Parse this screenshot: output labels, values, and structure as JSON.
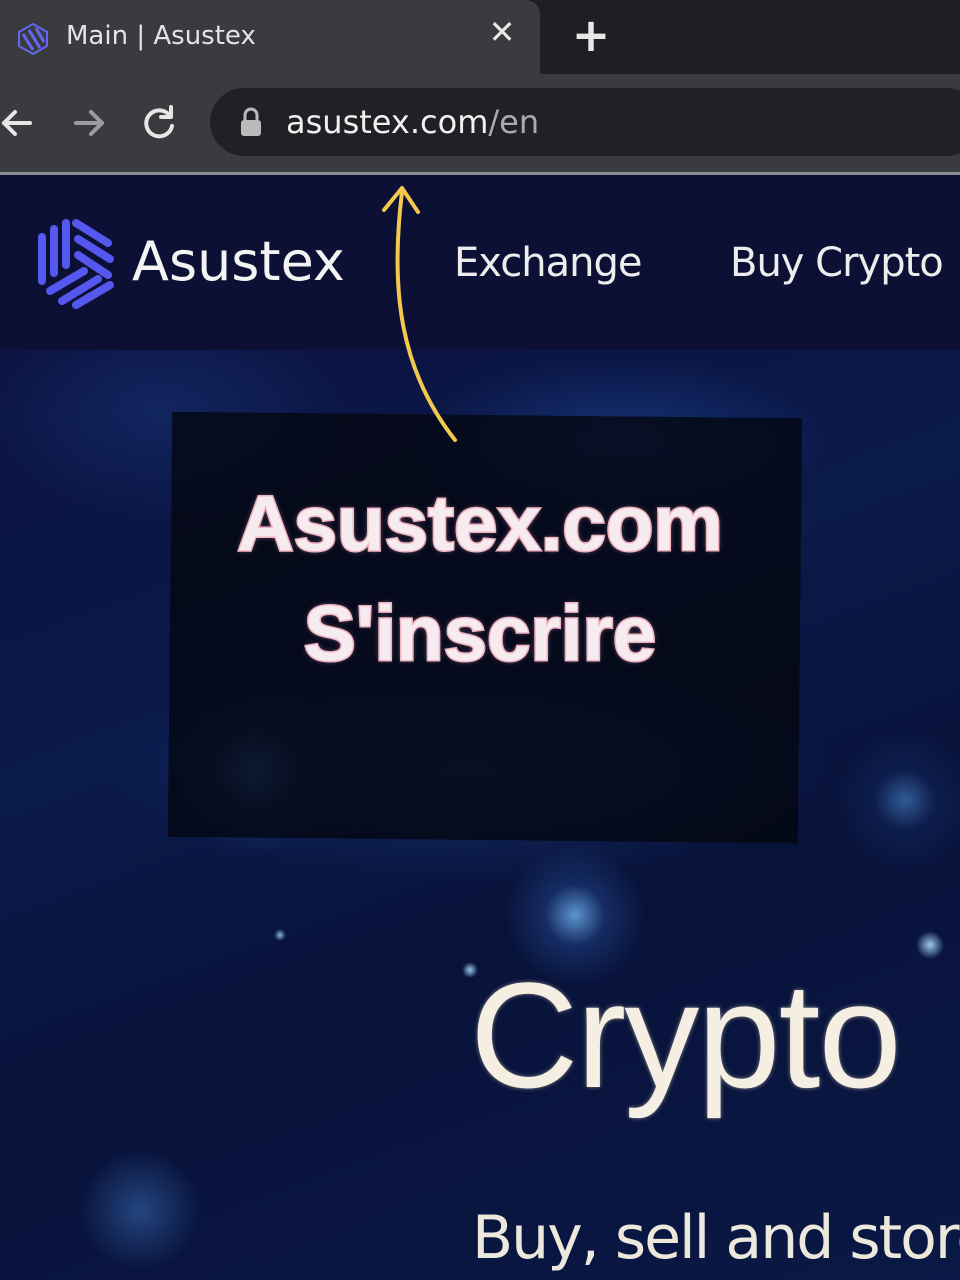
{
  "browser": {
    "tab_title": "Main | Asustex",
    "tab_close_icon": "close-icon",
    "new_tab_icon": "plus-icon",
    "url_host": "asustex.com",
    "url_path": "/en"
  },
  "site": {
    "logo_text": "Asustex",
    "nav": {
      "exchange": "Exchange",
      "buy_crypto": "Buy Crypto"
    },
    "hero": {
      "title": "Crypto",
      "subtitle": "Buy, sell and store"
    }
  },
  "overlay": {
    "line1": "Asustex.com",
    "line2": "S'inscrire"
  },
  "colors": {
    "brand_accent": "#5b5ff0",
    "annotation_arrow": "#f2c94c",
    "overlay_text_outline": "#f0b6c4"
  }
}
